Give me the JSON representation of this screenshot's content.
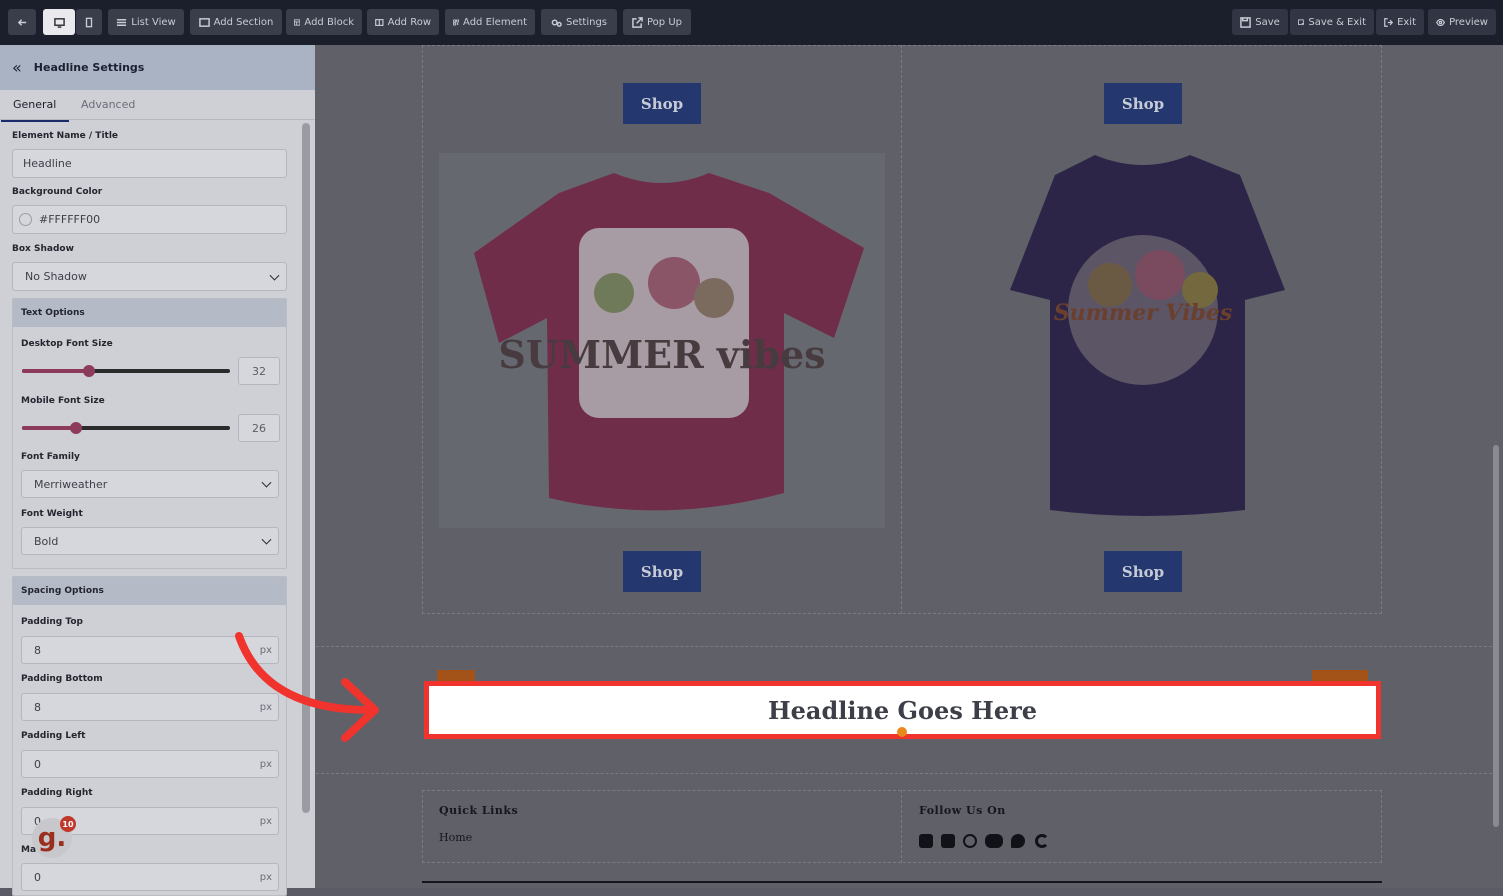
{
  "toolbar": {
    "list_view": "List View",
    "add_section": "Add Section",
    "add_block": "Add Block",
    "add_row": "Add Row",
    "add_element": "Add Element",
    "settings": "Settings",
    "pop_up": "Pop Up",
    "save": "Save",
    "save_exit": "Save & Exit",
    "exit": "Exit",
    "preview": "Preview"
  },
  "panel": {
    "title": "Headline Settings",
    "tabs": [
      "General",
      "Advanced"
    ],
    "element_name_label": "Element Name / Title",
    "element_name_value": "Headline",
    "bg_color_label": "Background Color",
    "bg_color_value": "#FFFFFF00",
    "box_shadow_label": "Box Shadow",
    "box_shadow_value": "No Shadow",
    "text_options": {
      "title": "Text Options",
      "desktop_font_label": "Desktop Font Size",
      "desktop_font_value": "32",
      "desktop_slider_level": 0.32,
      "mobile_font_label": "Mobile Font Size",
      "mobile_font_value": "26",
      "mobile_slider_level": 0.26,
      "font_family_label": "Font Family",
      "font_family_value": "Merriweather",
      "font_weight_label": "Font Weight",
      "font_weight_value": "Bold"
    },
    "spacing_options": {
      "title": "Spacing Options",
      "padding_top_label": "Padding Top",
      "padding_top_value": "8",
      "padding_bottom_label": "Padding Bottom",
      "padding_bottom_value": "8",
      "padding_left_label": "Padding Left",
      "padding_left_value": "0",
      "padding_right_label": "Padding Right",
      "padding_right_value": "0",
      "unit": "px",
      "last_value": "0",
      "partial_label": "Ma"
    }
  },
  "canvas": {
    "shop_label": "Shop",
    "headline": "Headline Goes Here",
    "footer": {
      "quick_links": "Quick Links",
      "home": "Home",
      "follow_us": "Follow Us On"
    },
    "tshirt_pink_text": "SUMMER vibes",
    "tshirt_purple_text": "Summer Vibes"
  },
  "badge": {
    "letter": "g.",
    "count": "10"
  },
  "colors": {
    "accent_red": "#f0332d",
    "shop_button": "#24386f"
  }
}
